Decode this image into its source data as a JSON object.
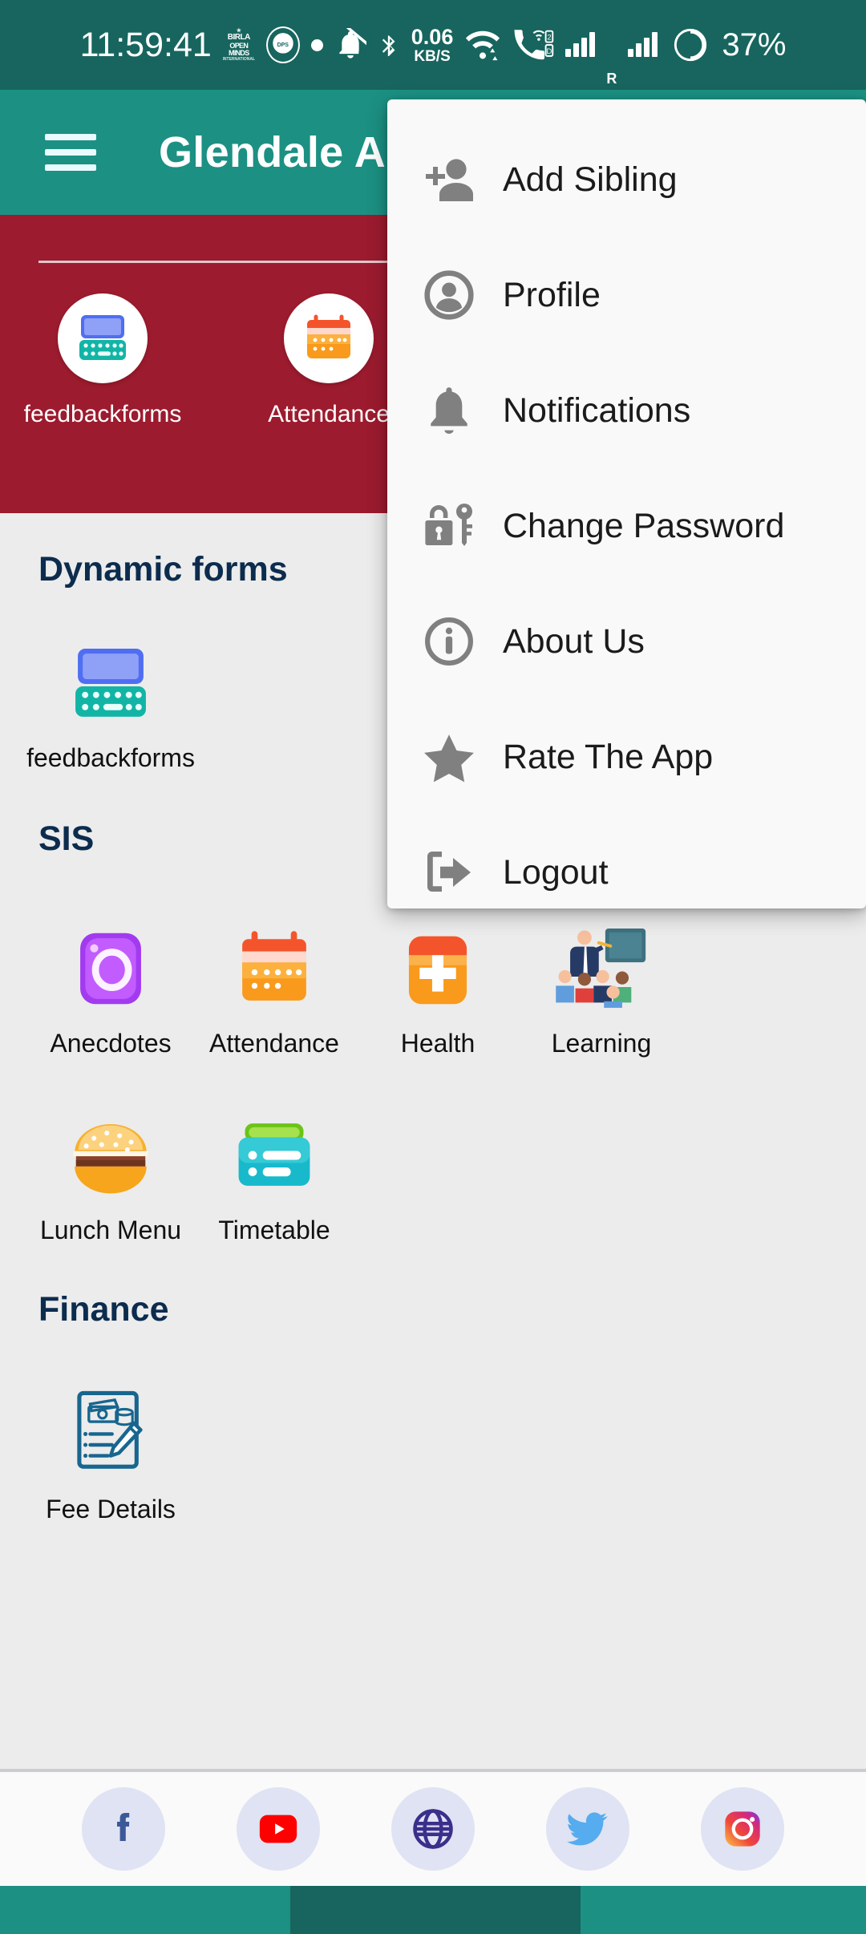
{
  "statusbar": {
    "time": "11:59:41",
    "logo1_lines": [
      "BIRLA",
      "OPEN MINDS",
      "INTERNATIONAL SCHOOL"
    ],
    "logo2_label": "DPS",
    "net_speed_value": "0.06",
    "net_speed_unit": "KB/S",
    "roaming_label": "R",
    "battery_percent": "37%",
    "icons": [
      "school-logo-icon",
      "school-crest-icon",
      "dot-icon",
      "mute-bell-icon",
      "bluetooth-icon",
      "network-speed-icon",
      "wifi-icon",
      "call-wifi-icon",
      "sim1-signal-icon",
      "sim2-signal-icon",
      "battery-icon"
    ]
  },
  "appbar": {
    "menu_icon": "hamburger-icon",
    "title": "Glendale A"
  },
  "quick_access": {
    "items": [
      {
        "label": "feedbackforms",
        "icon": "feedback-form-icon"
      },
      {
        "label": "Attendance",
        "icon": "calendar-icon"
      }
    ]
  },
  "sections": [
    {
      "title": "Dynamic forms",
      "tiles": [
        {
          "label": "feedbackforms",
          "icon": "feedback-form-icon"
        }
      ]
    },
    {
      "title": "SIS",
      "tiles": [
        {
          "label": "Anecdotes",
          "icon": "camera-icon"
        },
        {
          "label": "Attendance",
          "icon": "calendar-icon"
        },
        {
          "label": "Health",
          "icon": "health-cross-icon"
        },
        {
          "label": "Learning",
          "icon": "teacher-classroom-icon"
        },
        {
          "label": "Lunch Menu",
          "icon": "burger-icon"
        },
        {
          "label": "Timetable",
          "icon": "timetable-icon"
        }
      ]
    },
    {
      "title": "Finance",
      "tiles": [
        {
          "label": "Fee Details",
          "icon": "fee-document-icon"
        }
      ]
    }
  ],
  "social": {
    "items": [
      {
        "name": "facebook-icon",
        "label": "Facebook"
      },
      {
        "name": "youtube-icon",
        "label": "YouTube"
      },
      {
        "name": "website-icon",
        "label": "Website"
      },
      {
        "name": "twitter-icon",
        "label": "Twitter"
      },
      {
        "name": "instagram-icon",
        "label": "Instagram"
      }
    ]
  },
  "menu": {
    "items": [
      {
        "label": "Add Sibling",
        "icon": "add-person-icon"
      },
      {
        "label": "Profile",
        "icon": "profile-icon"
      },
      {
        "label": "Notifications",
        "icon": "bell-icon"
      },
      {
        "label": "Change Password",
        "icon": "lock-key-icon"
      },
      {
        "label": "About Us",
        "icon": "info-icon"
      },
      {
        "label": "Rate The App",
        "icon": "star-icon"
      },
      {
        "label": "Logout",
        "icon": "logout-icon"
      }
    ]
  },
  "colors": {
    "status_bar": "#17655e",
    "app_bar": "#1c9083",
    "quick_strip": "#9c1b2e",
    "content_bg": "#ececec",
    "section_title": "#0c2c4e",
    "menu_bg": "#f9f9f9"
  }
}
